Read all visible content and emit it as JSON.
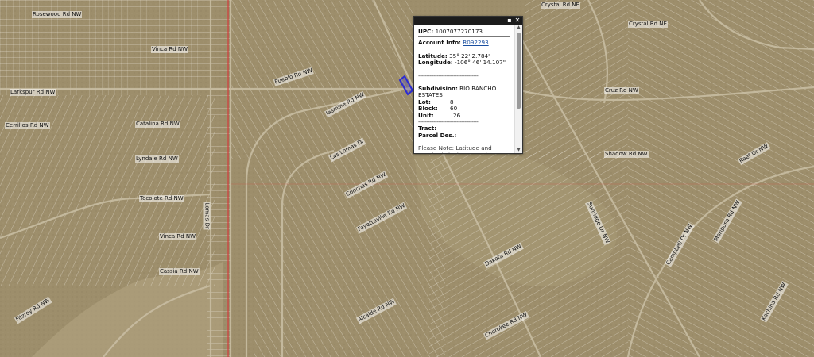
{
  "popup": {
    "upc_label": "UPC:",
    "upc_value": "1007077270173",
    "account_label": "Account Info:",
    "account_value": "R092293",
    "latitude_label": "Latitude:",
    "latitude_value": "35° 22' 2.784\"",
    "longitude_label": "Longitude:",
    "longitude_value": "-106° 46' 14.107\"",
    "separator": "------------------------------------",
    "subdivision_label": "Subdivision:",
    "subdivision_value": "RIO RANCHO ESTATES",
    "lot_label": "Lot:",
    "lot_value": "8",
    "block_label": "Block:",
    "block_value": "60",
    "unit_label": "Unit:",
    "unit_value": "26",
    "tract_label": "Tract:",
    "parcel_label": "Parcel Des.:",
    "note": "Please Note: Latitude and Longitude is the approximate center of the parcel shown."
  },
  "map": {
    "street_labels": [
      "Rosewood Rd NW",
      "Vinca Rd NW",
      "Larkspur Rd NW",
      "Cerrillos Rd NW",
      "Catalina Rd NW",
      "Lyndale Rd NW",
      "Tecolote Rd NW",
      "Vinca Rd NW",
      "Cassia Rd NW",
      "Pueblo Rd NW",
      "Jasmine Rd NW",
      "Las Lomas Dr",
      "Conchas Rd NW",
      "Fayetteville Rd NW",
      "Lomas Dr",
      "Dakota Rd NW",
      "Sunridge Dr NW",
      "Mariposa Rd NW",
      "Reef Dr NW",
      "Alcalde Rd NW",
      "Fitzroy Rd NW",
      "Campbell Dr NW",
      "Kachina Rd NW",
      "Shadow Rd NW",
      "Cruz Rd NW",
      "Cherokee Rd NW",
      "Crystal Rd NE",
      "Crystal Rd NE"
    ]
  },
  "colors": {
    "parcel_highlight": "#2b2bd6",
    "boundary_line": "#d23a3a",
    "popup_header": "#1c1c1c",
    "link": "#1a4fa0"
  }
}
